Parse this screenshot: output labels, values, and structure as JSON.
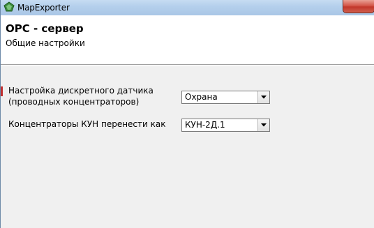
{
  "window": {
    "title": "MapExporter"
  },
  "header": {
    "title": "OPC - сервер",
    "subtitle": "Общие настройки"
  },
  "form": {
    "discrete_sensor": {
      "label_line1": "Настройка дискретного датчика",
      "label_line2": "(проводных концентраторов)",
      "value": "Охрана"
    },
    "kun_concentrators": {
      "label": "Концентраторы КУН перенести как",
      "value": "КУН-2Д.1"
    }
  },
  "icons": {
    "app": "map-exporter-icon",
    "close": "close-icon",
    "dropdown": "chevron-down-icon"
  },
  "colors": {
    "titlebar": "#b5d0ec",
    "close_button": "#c2362a",
    "header_bg": "#ffffff",
    "body_bg": "#f0f0f0"
  }
}
